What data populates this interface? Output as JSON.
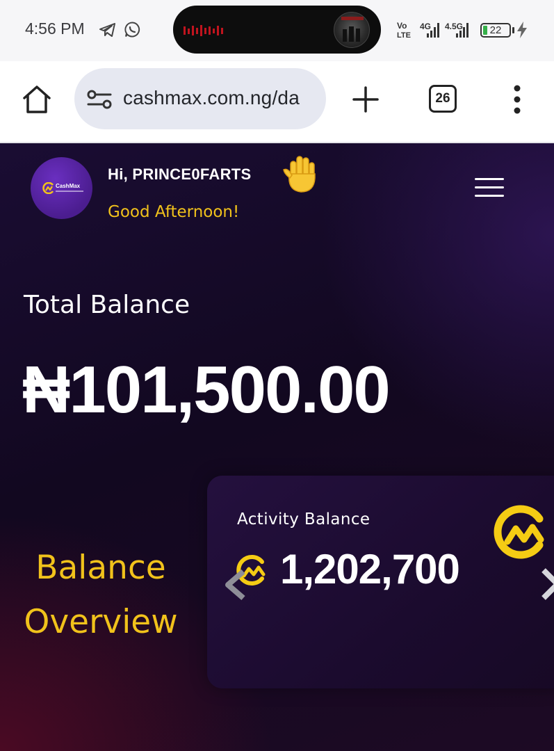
{
  "status_bar": {
    "time": "4:56 PM",
    "battery_level": "22",
    "network": {
      "volte_top": "Vo",
      "volte_bottom": "LTE",
      "sim1": "4G",
      "sim2": "4.5G"
    },
    "icons": [
      "telegram-icon",
      "whatsapp-icon",
      "media-waveform-icon",
      "signal-icon",
      "battery-icon",
      "charging-bolt-icon"
    ]
  },
  "browser": {
    "url": "cashmax.com.ng/da",
    "tab_count": "26",
    "icons": [
      "home-icon",
      "site-settings-icon",
      "new-tab-plus-icon",
      "tabs-count-icon",
      "overflow-menu-icon"
    ]
  },
  "header": {
    "logo_text": "CashMax",
    "greeting": "Hi, PRINCE0FARTS",
    "salutation": "Good Afternoon!",
    "emoji": "raised-hand"
  },
  "balance": {
    "label": "Total Balance",
    "value": "₦101,500.00"
  },
  "overview": {
    "line1": "Balance",
    "line2": "Overview"
  },
  "activity_card": {
    "label": "Activity Balance",
    "value": "1,202,700"
  },
  "colors": {
    "accent": "#f1c21b",
    "background": "#160a24",
    "logo_purple": "#4b1d8f",
    "text": "#ffffff"
  }
}
